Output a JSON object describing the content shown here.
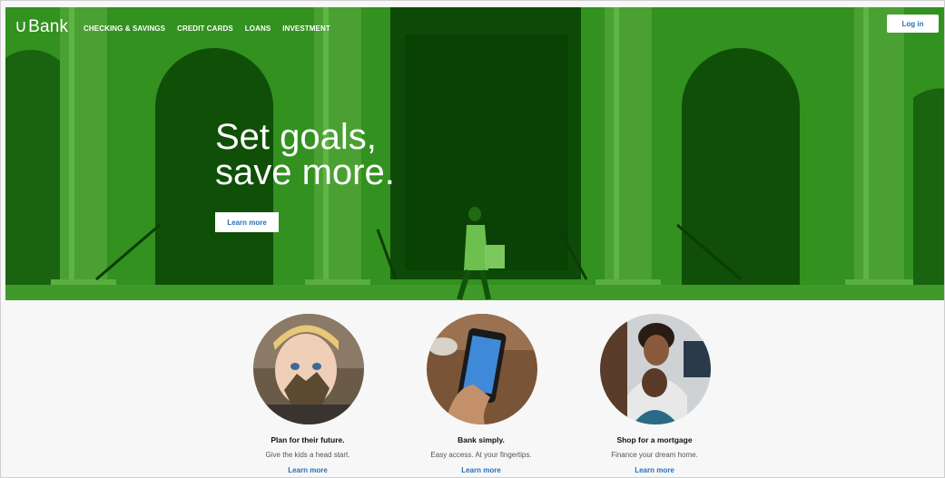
{
  "brand": {
    "logo_mark": "∪",
    "logo_text": "Bank"
  },
  "nav": {
    "links": [
      "CHECKING & SAVINGS",
      "CREDIT CARDS",
      "LOANS",
      "INVESTMENT"
    ],
    "login_label": "Log in"
  },
  "hero": {
    "headline_line1": "Set goals,",
    "headline_line2": "save more.",
    "cta_label": "Learn more"
  },
  "cards": [
    {
      "title": "Plan for their future.",
      "subtitle": "Give the kids a head start.",
      "link": "Learn more",
      "image": "child-with-leaf-photo"
    },
    {
      "title": "Bank simply.",
      "subtitle": "Easy access. At your fingertips.",
      "link": "Learn more",
      "image": "hand-holding-phone-photo"
    },
    {
      "title": "Shop for a mortgage",
      "subtitle": "Finance your dream home.",
      "link": "Learn more",
      "image": "smiling-couple-photo"
    }
  ],
  "colors": {
    "hero_green": "#2f8a1f",
    "link_blue": "#2a6fb8"
  }
}
